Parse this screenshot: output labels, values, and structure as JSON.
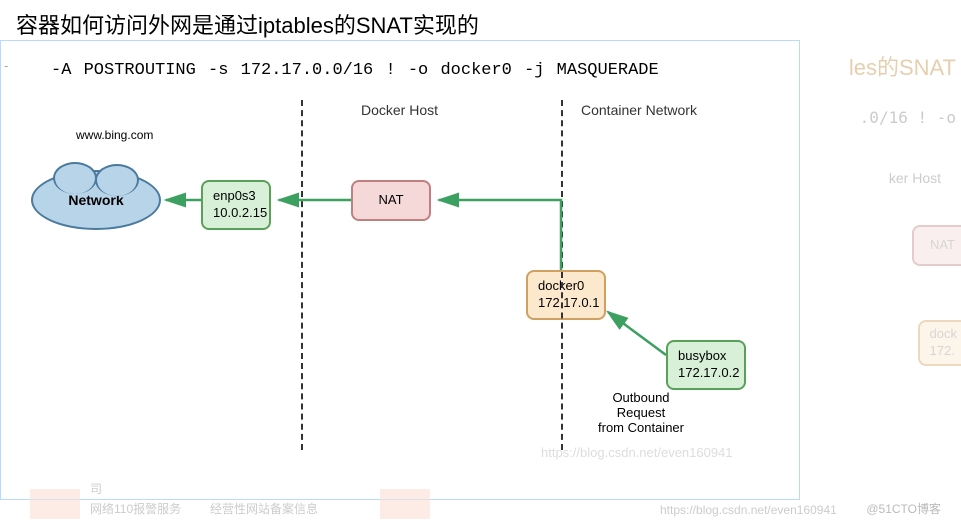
{
  "title": "容器如何访问外网是通过iptables的SNAT实现的",
  "command": "-A POSTROUTING -s 172.17.0.0/16 ! -o docker0 -j MASQUERADE",
  "sections": {
    "host": "Docker Host",
    "container": "Container Network"
  },
  "cloud": {
    "label": "Network",
    "site": "www.bing.com"
  },
  "nodes": {
    "enp0s3": {
      "name": "enp0s3",
      "ip": "10.0.2.15"
    },
    "nat": {
      "name": "NAT"
    },
    "docker0": {
      "name": "docker0",
      "ip": "172.17.0.1"
    },
    "busybox": {
      "name": "busybox",
      "ip": "172.17.0.2"
    }
  },
  "caption": "Outbound\nRequest\nfrom Container",
  "ghost": {
    "title_frag": "les的SNAT",
    "cmd_frag": ".0/16 ! -o",
    "host_frag": "ker Host",
    "nat_frag": "NAT",
    "docker_frag_name": "dock",
    "docker_frag_ip": "172."
  },
  "footer": {
    "item1": "司",
    "item2": "网络110报警服务",
    "item3": "经营性网站备案信息",
    "wm1": "https://blog.csdn.net/even160941",
    "wm2": "https://blog.csdn.net/even160941",
    "wm3": "@51CTO博客"
  },
  "colors": {
    "arrow": "#3ca060"
  }
}
